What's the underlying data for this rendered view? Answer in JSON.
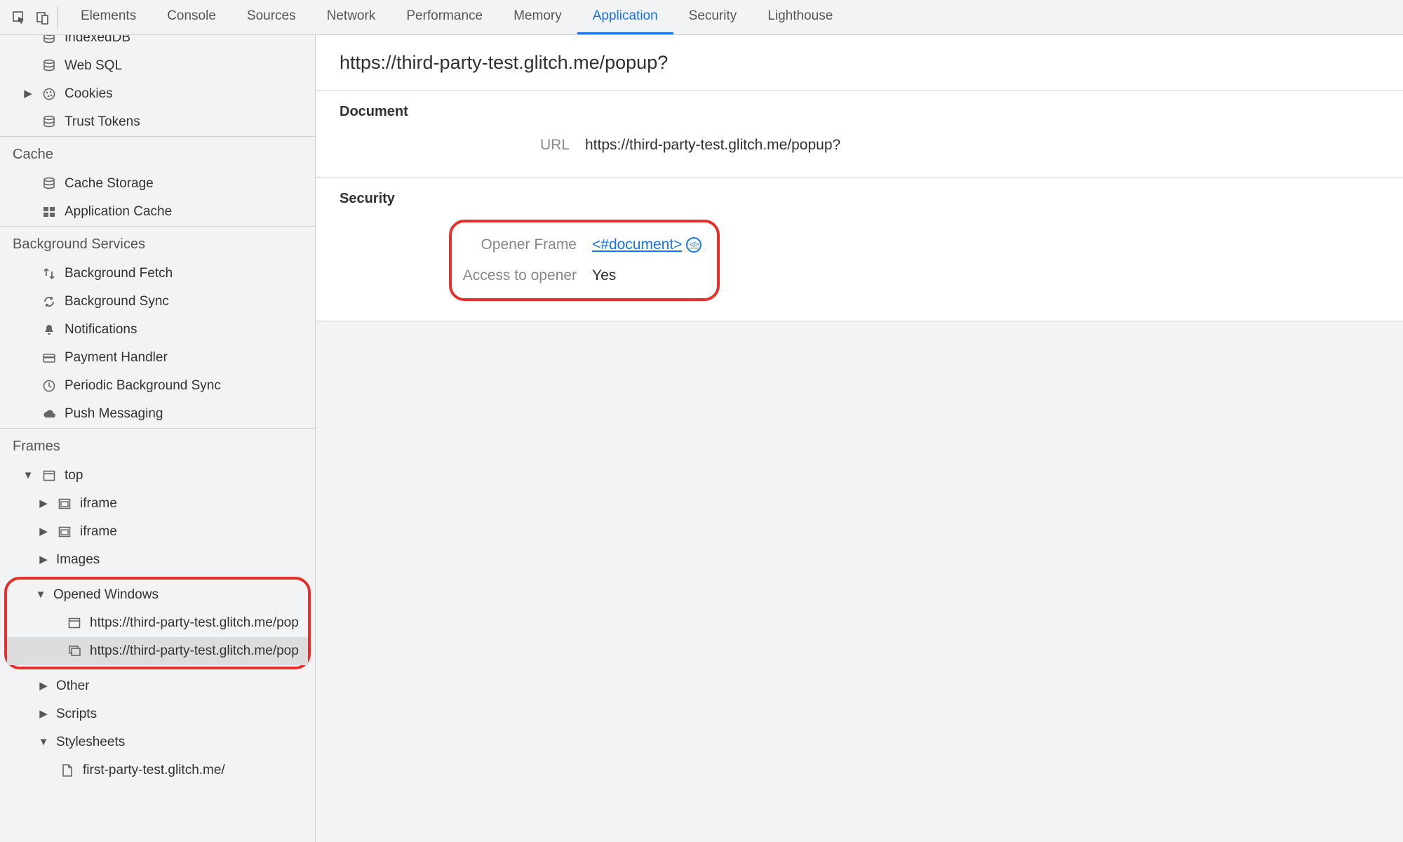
{
  "tabs": {
    "elements": "Elements",
    "console": "Console",
    "sources": "Sources",
    "network": "Network",
    "performance": "Performance",
    "memory": "Memory",
    "application": "Application",
    "security": "Security",
    "lighthouse": "Lighthouse"
  },
  "sidebar": {
    "storage": {
      "indexeddb": "IndexedDB",
      "websql": "Web SQL",
      "cookies": "Cookies",
      "trust_tokens": "Trust Tokens"
    },
    "cache_label": "Cache",
    "cache": {
      "cache_storage": "Cache Storage",
      "application_cache": "Application Cache"
    },
    "bgsvc_label": "Background Services",
    "bgsvc": {
      "fetch": "Background Fetch",
      "sync": "Background Sync",
      "notifications": "Notifications",
      "payment": "Payment Handler",
      "periodic": "Periodic Background Sync",
      "push": "Push Messaging"
    },
    "frames_label": "Frames",
    "frames": {
      "top": "top",
      "iframe1": "iframe",
      "iframe2": "iframe",
      "images": "Images",
      "opened_windows": "Opened Windows",
      "ow_item1": "https://third-party-test.glitch.me/popup?",
      "ow_item2": "https://third-party-test.glitch.me/popup?",
      "other": "Other",
      "scripts": "Scripts",
      "stylesheets": "Stylesheets",
      "stylesheet1": "first-party-test.glitch.me/"
    }
  },
  "content": {
    "title": "https://third-party-test.glitch.me/popup?",
    "document_label": "Document",
    "url_label": "URL",
    "url_value": "https://third-party-test.glitch.me/popup?",
    "security_label": "Security",
    "opener_frame_label": "Opener Frame",
    "opener_frame_value": "<#document>",
    "access_label": "Access to opener",
    "access_value": "Yes"
  }
}
